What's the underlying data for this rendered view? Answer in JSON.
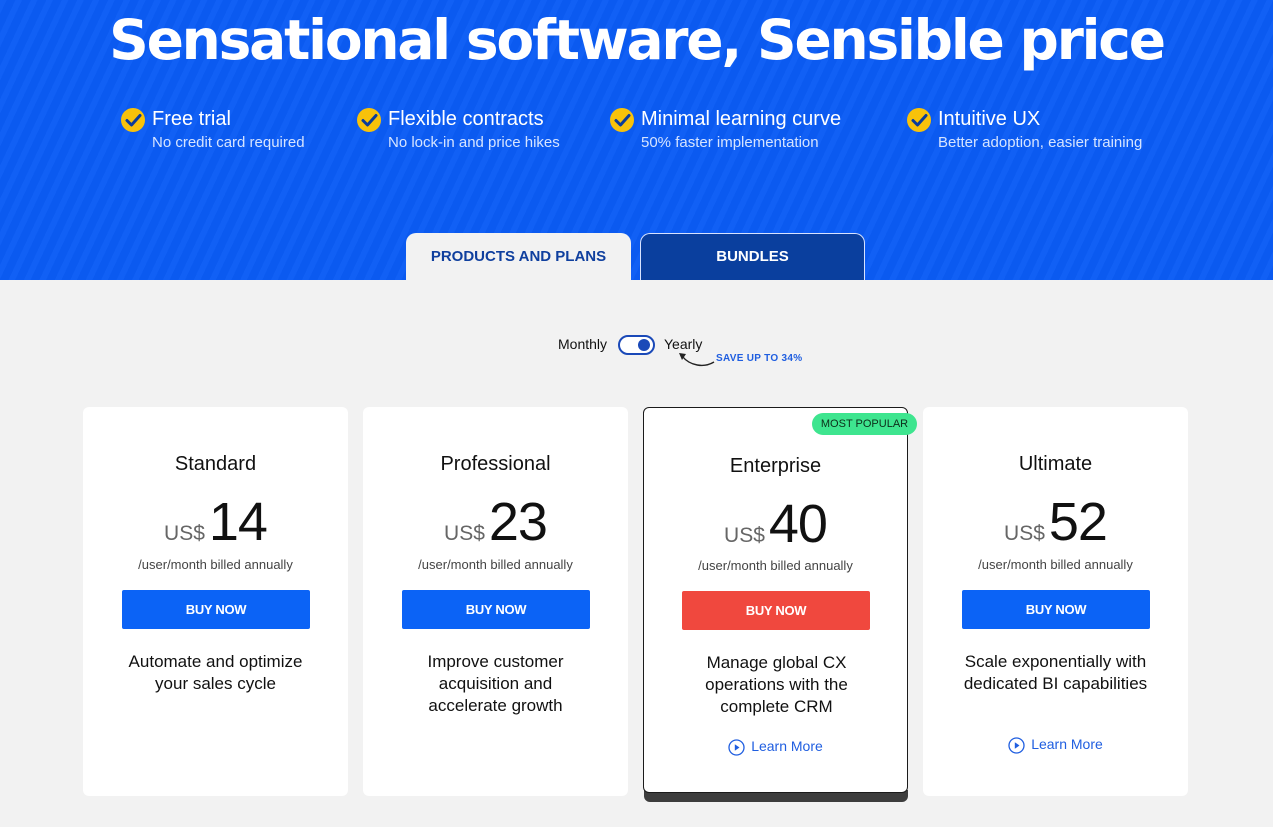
{
  "hero": {
    "title": "Sensational software, Sensible price",
    "features": [
      {
        "title": "Free trial",
        "subtitle": "No credit card required"
      },
      {
        "title": "Flexible contracts",
        "subtitle": "No lock-in and price hikes"
      },
      {
        "title": "Minimal learning curve",
        "subtitle": "50% faster implementation"
      },
      {
        "title": "Intuitive UX",
        "subtitle": "Better adoption, easier training"
      }
    ]
  },
  "tabs": {
    "products": "PRODUCTS AND PLANS",
    "bundles": "BUNDLES",
    "active": "products"
  },
  "billing_toggle": {
    "monthly": "Monthly",
    "yearly": "Yearly",
    "selected": "yearly",
    "save_note": "SAVE UP TO 34%"
  },
  "plans": [
    {
      "name": "Standard",
      "currency": "US$",
      "price": "14",
      "billing": "/user/month billed annually",
      "cta": "BUY NOW",
      "description": "Automate and optimize your sales cycle"
    },
    {
      "name": "Professional",
      "currency": "US$",
      "price": "23",
      "billing": "/user/month billed annually",
      "cta": "BUY NOW",
      "description": "Improve customer acquisition and accelerate growth"
    },
    {
      "name": "Enterprise",
      "currency": "US$",
      "price": "40",
      "billing": "/user/month billed annually",
      "cta": "BUY NOW",
      "description": "Manage global CX operations with the complete CRM",
      "badge": "MOST POPULAR",
      "learn_more": "Learn More"
    },
    {
      "name": "Ultimate",
      "currency": "US$",
      "price": "52",
      "billing": "/user/month billed annually",
      "cta": "BUY NOW",
      "description": "Scale exponentially with dedicated BI capabilities",
      "learn_more": "Learn More"
    }
  ],
  "colors": {
    "hero_bg": "#0b5cf5",
    "check": "#f8c20a",
    "buy_button": "#0b63f6",
    "featured_buy_button": "#f0483e",
    "badge": "#3ee58f",
    "link": "#1f5ee0"
  },
  "icons": {
    "feature_check": "check-circle-icon",
    "learn_more": "play-circle-icon",
    "save_arrow": "curved-arrow-icon"
  }
}
